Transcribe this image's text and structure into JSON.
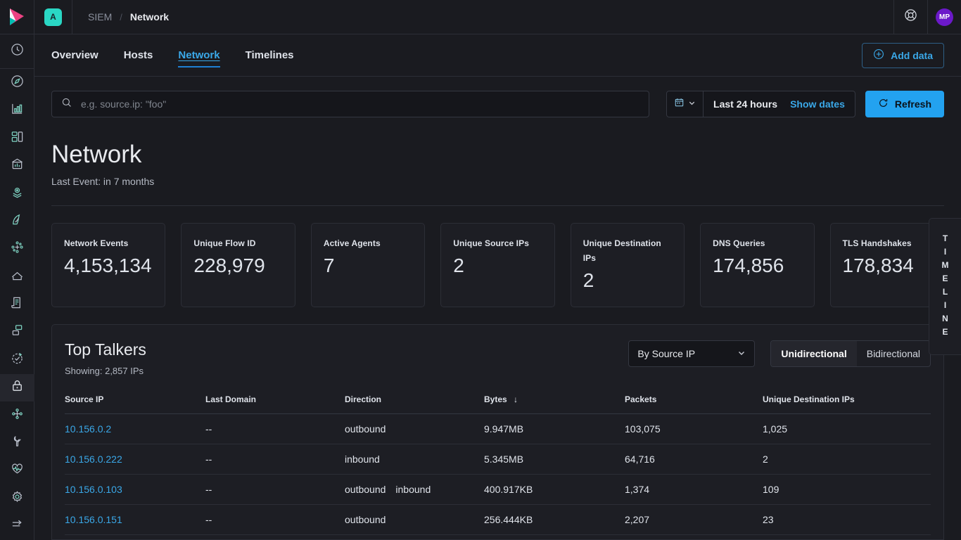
{
  "topbar": {
    "logo_icon": "kibana-logo",
    "space_badge": "A",
    "breadcrumbs": [
      {
        "label": "SIEM",
        "active": false
      },
      {
        "label": "Network",
        "active": true
      }
    ],
    "help_icon": "lifebuoy-icon",
    "avatar_initials": "MP",
    "avatar_color": "#6b19c9"
  },
  "rail": {
    "items": [
      {
        "name": "recently-viewed",
        "icon": "clock-icon"
      },
      {
        "name": "discover",
        "icon": "compass-icon"
      },
      {
        "name": "visualize",
        "icon": "bar-chart-icon"
      },
      {
        "name": "dashboard",
        "icon": "dashboard-icon"
      },
      {
        "name": "canvas",
        "icon": "canvas-icon"
      },
      {
        "name": "maps",
        "icon": "map-pin-icon"
      },
      {
        "name": "machine-learning",
        "icon": "ml-icon"
      },
      {
        "name": "graph",
        "icon": "graph-icon"
      },
      {
        "name": "apm",
        "icon": "apm-icon"
      },
      {
        "name": "logs",
        "icon": "logs-icon"
      },
      {
        "name": "infrastructure",
        "icon": "infrastructure-icon"
      },
      {
        "name": "uptime",
        "icon": "uptime-icon"
      },
      {
        "name": "siem",
        "icon": "lock-icon"
      },
      {
        "name": "dev-tools-nodes",
        "icon": "nodes-icon"
      },
      {
        "name": "dev-tools",
        "icon": "wrench-icon"
      },
      {
        "name": "monitoring",
        "icon": "heartbeat-icon"
      },
      {
        "name": "management",
        "icon": "gear-icon"
      },
      {
        "name": "collapse-nav",
        "icon": "arrow-collapse-icon"
      }
    ]
  },
  "tabs": [
    {
      "label": "Overview",
      "active": false
    },
    {
      "label": "Hosts",
      "active": false
    },
    {
      "label": "Network",
      "active": true
    },
    {
      "label": "Timelines",
      "active": false
    }
  ],
  "add_data": {
    "label": "Add data",
    "icon": "plus-circle-icon"
  },
  "search": {
    "icon": "search-icon",
    "placeholder": "e.g. source.ip: \"foo\"",
    "value": ""
  },
  "datepicker": {
    "calendar_icon": "calendar-icon",
    "chevron_icon": "chevron-down-icon",
    "range_label": "Last 24 hours",
    "show_dates_label": "Show dates"
  },
  "refresh": {
    "label": "Refresh",
    "icon": "refresh-icon"
  },
  "page": {
    "title": "Network",
    "subtitle": "Last Event: in 7 months"
  },
  "stats": [
    {
      "title": "Network Events",
      "value": "4,153,134"
    },
    {
      "title": "Unique Flow ID",
      "value": "228,979"
    },
    {
      "title": "Active Agents",
      "value": "7"
    },
    {
      "title": "Unique Source IPs",
      "value": "2"
    },
    {
      "title": "Unique Destination IPs",
      "value": "2"
    },
    {
      "title": "DNS Queries",
      "value": "174,856"
    },
    {
      "title": "TLS Handshakes",
      "value": "178,834"
    }
  ],
  "top_talkers": {
    "title": "Top Talkers",
    "showing": "Showing: 2,857 IPs",
    "select": {
      "value": "By Source IP",
      "chevron_icon": "chevron-down-icon"
    },
    "direction_toggle": {
      "options": [
        "Unidirectional",
        "Bidirectional"
      ],
      "selected": "Unidirectional"
    },
    "columns": [
      {
        "label": "Source IP",
        "sorted": false
      },
      {
        "label": "Last Domain",
        "sorted": false
      },
      {
        "label": "Direction",
        "sorted": false
      },
      {
        "label": "Bytes",
        "sorted": true,
        "sort_icon": "↓"
      },
      {
        "label": "Packets",
        "sorted": false
      },
      {
        "label": "Unique Destination IPs",
        "sorted": false
      }
    ],
    "rows": [
      {
        "source_ip": "10.156.0.2",
        "last_domain": "--",
        "direction": [
          "outbound"
        ],
        "bytes": "9.947MB",
        "packets": "103,075",
        "unique_destination_ips": "1,025"
      },
      {
        "source_ip": "10.156.0.222",
        "last_domain": "--",
        "direction": [
          "inbound"
        ],
        "bytes": "5.345MB",
        "packets": "64,716",
        "unique_destination_ips": "2"
      },
      {
        "source_ip": "10.156.0.103",
        "last_domain": "--",
        "direction": [
          "outbound",
          "inbound"
        ],
        "bytes": "400.917KB",
        "packets": "1,374",
        "unique_destination_ips": "109"
      },
      {
        "source_ip": "10.156.0.151",
        "last_domain": "--",
        "direction": [
          "outbound"
        ],
        "bytes": "256.444KB",
        "packets": "2,207",
        "unique_destination_ips": "23"
      }
    ]
  },
  "timeline_tab": {
    "letters": [
      "T",
      "I",
      "M",
      "E",
      "L",
      "I",
      "N",
      "E"
    ]
  }
}
